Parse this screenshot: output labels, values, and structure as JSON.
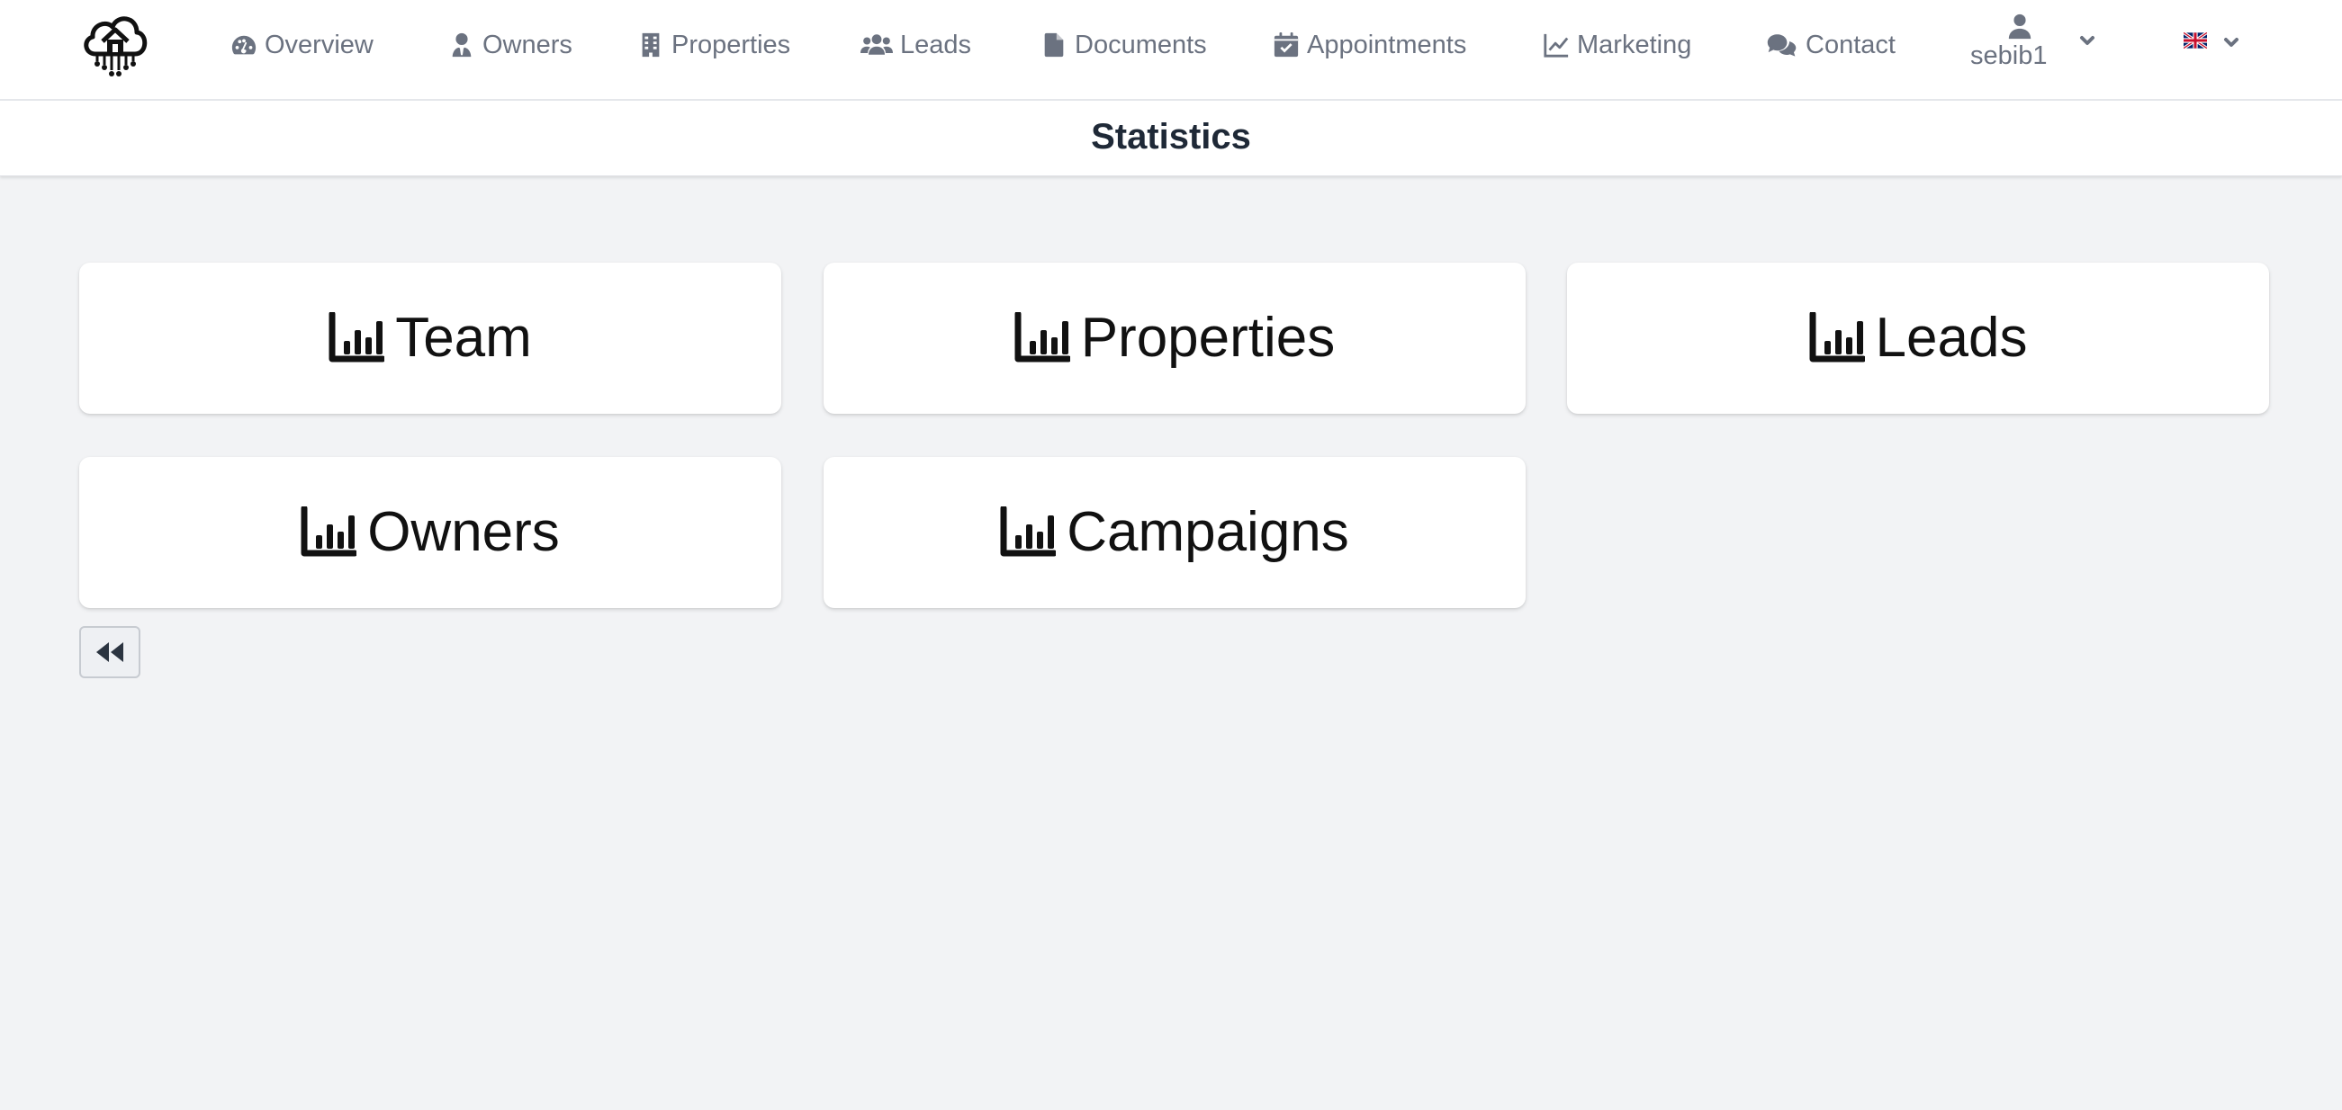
{
  "nav": {
    "items": [
      {
        "label": "Overview",
        "icon": "gauge-icon"
      },
      {
        "label": "Owners",
        "icon": "user-tie-icon"
      },
      {
        "label": "Properties",
        "icon": "building-icon"
      },
      {
        "label": "Leads",
        "icon": "users-icon"
      },
      {
        "label": "Documents",
        "icon": "file-icon"
      },
      {
        "label": "Appointments",
        "icon": "calendar-check-icon"
      },
      {
        "label": "Marketing",
        "icon": "chart-line-icon"
      },
      {
        "label": "Contact",
        "icon": "comments-icon"
      }
    ],
    "user": {
      "name": "sebib1",
      "icon": "user-icon"
    },
    "language": {
      "flag": "uk-flag-icon"
    }
  },
  "page": {
    "title": "Statistics"
  },
  "cards": [
    {
      "label": "Team",
      "icon": "chart-bar-icon"
    },
    {
      "label": "Properties",
      "icon": "chart-bar-icon"
    },
    {
      "label": "Leads",
      "icon": "chart-bar-icon"
    },
    {
      "label": "Owners",
      "icon": "chart-bar-icon"
    },
    {
      "label": "Campaigns",
      "icon": "chart-bar-icon"
    }
  ],
  "back_button": {
    "icon": "backward-icon"
  },
  "colors": {
    "background": "#f2f3f5",
    "nav_text": "#6b7280",
    "title": "#1f2937",
    "card_text": "#111111"
  }
}
